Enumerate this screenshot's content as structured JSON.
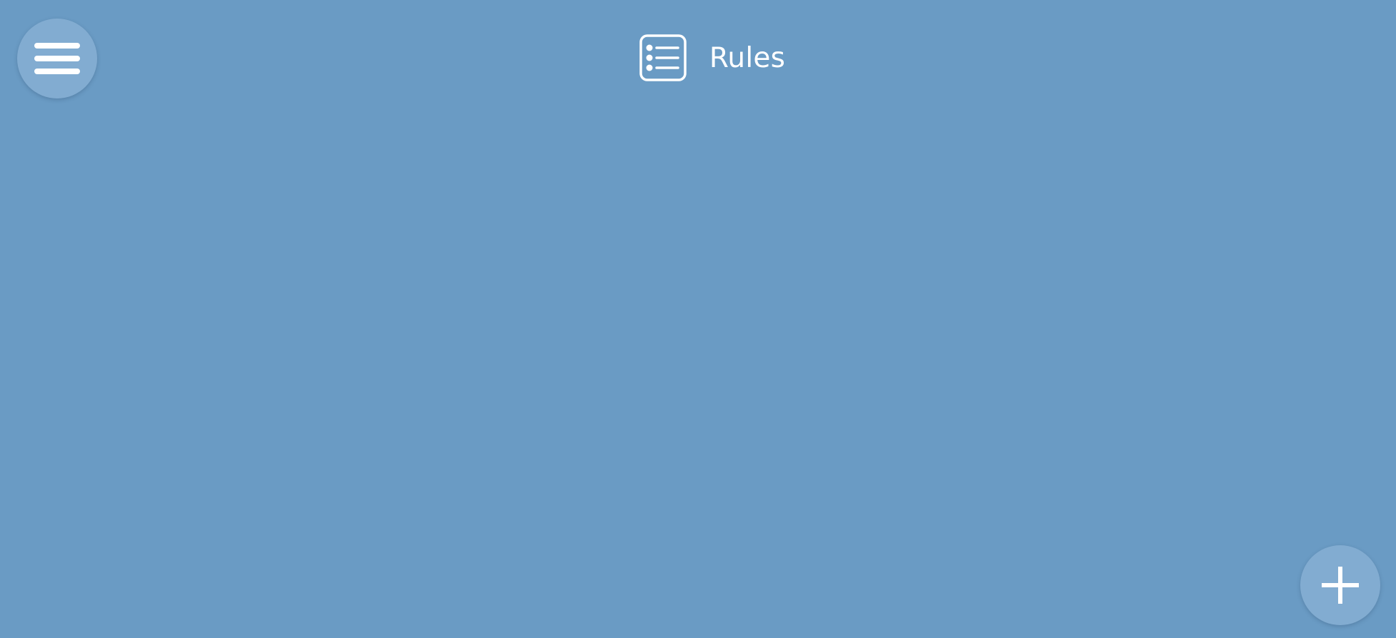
{
  "header": {
    "title": "Rules",
    "icon": "list-icon"
  },
  "toolbar": {
    "menu_icon": "hamburger-menu-icon",
    "add_icon": "plus-icon"
  },
  "colors": {
    "background": "#6a9bc4",
    "button": "#82acd1",
    "foreground": "#ffffff"
  }
}
